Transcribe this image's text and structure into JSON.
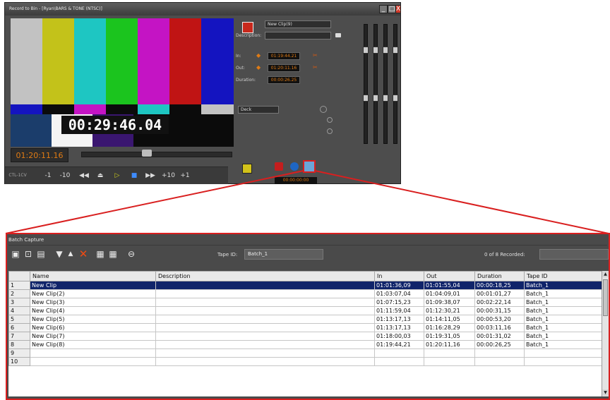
{
  "record_window": {
    "title": "Record to Bin - [Ryan\\BARS & TONE (NTSC)]",
    "window_buttons": {
      "minimize": "_",
      "maximize": "□",
      "close": "X"
    },
    "monitor": {
      "timecode_overlay": "00:29:46.04",
      "bar_colors": [
        "#c2c2c2",
        "#c3c21a",
        "#1ec6c2",
        "#1bc41e",
        "#c414c4",
        "#c01414",
        "#1414c0"
      ]
    },
    "timecode_readout": "01:20:11.16",
    "transport": {
      "label": "CTL-1CV",
      "buttons": [
        "-1",
        "-10",
        "◀◀",
        "⏏",
        "▷",
        "■",
        "▶▶",
        "+10",
        "+1"
      ]
    },
    "clip": {
      "name": "New Clip(9)",
      "description_label": "Description:",
      "description_value": "",
      "in_label": "In:",
      "in_value": "01:19:44.21",
      "out_label": "Out:",
      "out_value": "01:20:11.16",
      "duration_label": "Duration:",
      "duration_value": "00:00:26.25"
    },
    "deck_select": "Deck",
    "status_tc": "00:00:00:00"
  },
  "batch_capture": {
    "title": "Batch Capture",
    "tape_id_label": "Tape ID:",
    "tape_id_value": "Batch_1",
    "recorded_label": "0 of 8 Recorded:",
    "toolbar_icons": [
      "save-icon",
      "open-icon",
      "import-icon",
      "move-down-icon",
      "move-up-icon",
      "delete-icon",
      "record-all-icon",
      "record-selected-icon",
      "settings-icon"
    ],
    "columns": [
      "",
      "Name",
      "Description",
      "In",
      "Out",
      "Duration",
      "Tape ID",
      ""
    ],
    "rows": [
      {
        "num": "1",
        "name": "New Clip",
        "description": "",
        "in": "01:01:36,09",
        "out": "01:01:55,04",
        "duration": "00:00:18,25",
        "tape": "Batch_1",
        "selected": true
      },
      {
        "num": "2",
        "name": "New Clip(2)",
        "description": "",
        "in": "01:03:07,04",
        "out": "01:04:09,01",
        "duration": "00:01:01,27",
        "tape": "Batch_1"
      },
      {
        "num": "3",
        "name": "New Clip(3)",
        "description": "",
        "in": "01:07:15,23",
        "out": "01:09:38,07",
        "duration": "00:02:22,14",
        "tape": "Batch_1"
      },
      {
        "num": "4",
        "name": "New Clip(4)",
        "description": "",
        "in": "01:11:59,04",
        "out": "01:12:30,21",
        "duration": "00:00:31,15",
        "tape": "Batch_1"
      },
      {
        "num": "5",
        "name": "New Clip(5)",
        "description": "",
        "in": "01:13:17,13",
        "out": "01:14:11,05",
        "duration": "00:00:53,20",
        "tape": "Batch_1"
      },
      {
        "num": "6",
        "name": "New Clip(6)",
        "description": "",
        "in": "01:13:17,13",
        "out": "01:16:28,29",
        "duration": "00:03:11,16",
        "tape": "Batch_1"
      },
      {
        "num": "7",
        "name": "New Clip(7)",
        "description": "",
        "in": "01:18:00,03",
        "out": "01:19:31,05",
        "duration": "00:01:31,02",
        "tape": "Batch_1"
      },
      {
        "num": "8",
        "name": "New Clip(8)",
        "description": "",
        "in": "01:19:44,21",
        "out": "01:20:11,16",
        "duration": "00:00:26,25",
        "tape": "Batch_1"
      },
      {
        "num": "9",
        "name": "",
        "description": "",
        "in": "",
        "out": "",
        "duration": "",
        "tape": ""
      },
      {
        "num": "10",
        "name": "",
        "description": "",
        "in": "",
        "out": "",
        "duration": "",
        "tape": ""
      }
    ]
  },
  "colors": {
    "highlight_red": "#d91f1f",
    "selection_blue": "#10246a",
    "timecode_orange": "#e07b14"
  }
}
